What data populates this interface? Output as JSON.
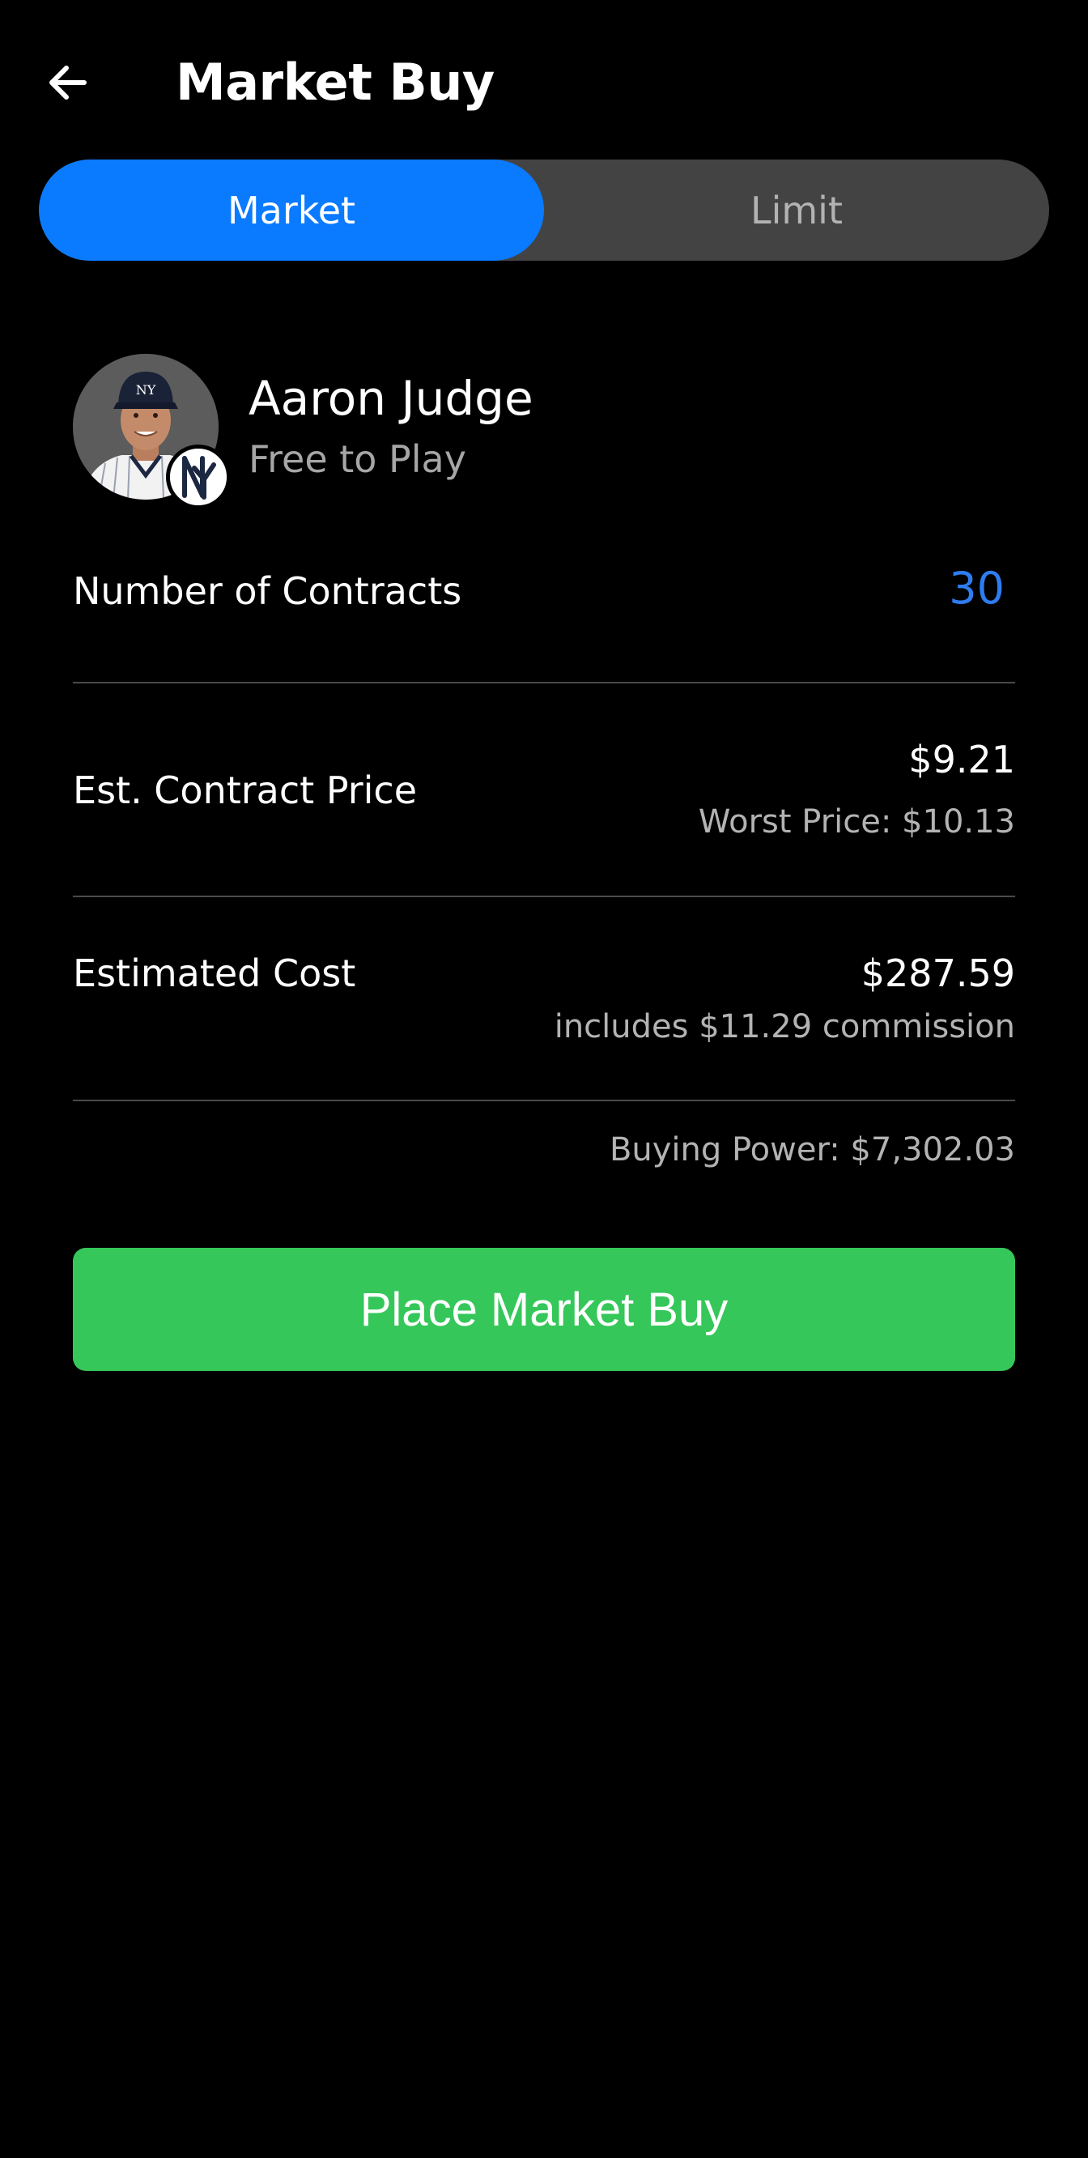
{
  "header": {
    "title": "Market Buy",
    "back_icon": "arrow-left-icon"
  },
  "order_type_tabs": [
    {
      "label": "Market",
      "selected": true
    },
    {
      "label": "Limit",
      "selected": false
    }
  ],
  "player": {
    "name": "Aaron Judge",
    "subtitle": "Free to Play",
    "team_logo": "ny-yankees-logo"
  },
  "contracts": {
    "label": "Number of Contracts",
    "value": "30"
  },
  "contract_price": {
    "label": "Est. Contract Price",
    "value": "$9.21",
    "worst_price": "Worst Price: $10.13"
  },
  "estimated_cost": {
    "label": "Estimated Cost",
    "value": "$287.59",
    "commission_note": "includes $11.29 commission"
  },
  "buying_power": "Buying Power: $7,302.03",
  "submit_button": {
    "label": "Place Market Buy"
  },
  "colors": {
    "background": "#000000",
    "tab_selected": "#0a7aff",
    "tab_track": "#434343",
    "accent_blue": "#2d7df0",
    "buy_green": "#35c759"
  }
}
